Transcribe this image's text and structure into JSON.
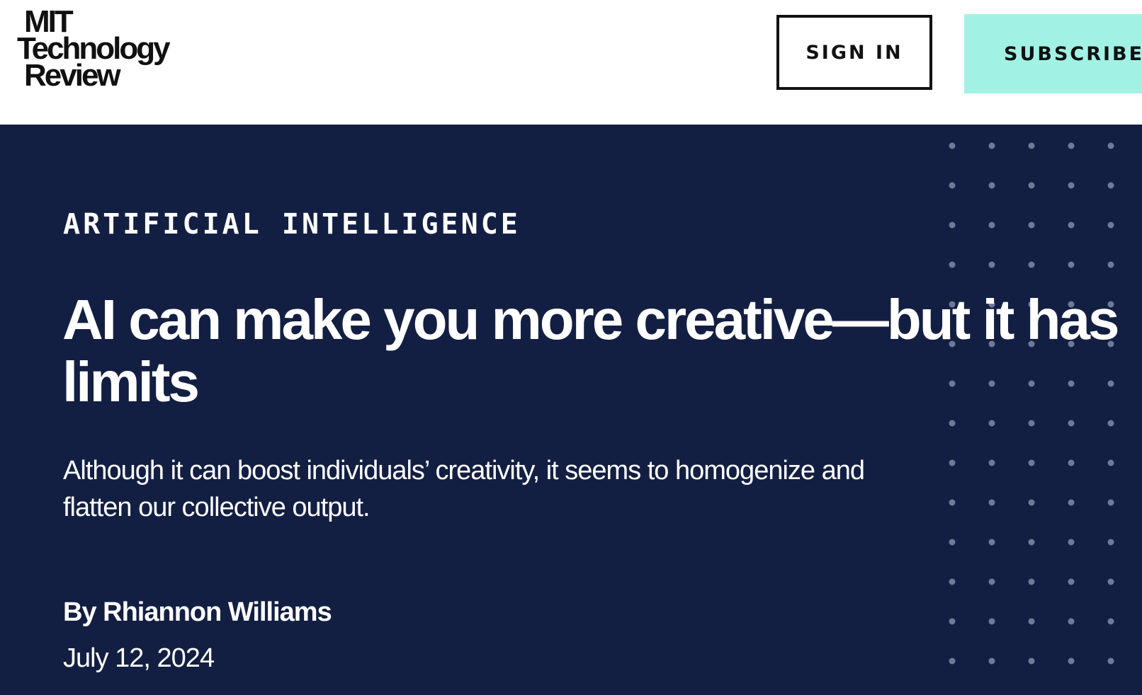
{
  "header": {
    "logo_lines": [
      "MIT",
      "Technology",
      "Review"
    ],
    "sign_in_label": "SIGN IN",
    "subscribe_label": "SUBSCRIBE"
  },
  "article": {
    "topic": "ARTIFICIAL INTELLIGENCE",
    "headline": "AI can make you more creative—but it has limits",
    "dek": "Although it can boost individuals’ creativity, it seems to homogenize and flatten our collective output.",
    "byline_prefix": "By",
    "author": "Rhiannon Williams",
    "date": "July 12, 2024"
  },
  "colors": {
    "hero_background": "#131f42",
    "subscribe_accent": "#a1f2e5",
    "dot_color": "#6f7a9a"
  },
  "icons": {
    "decor": "dot-grid-pattern"
  }
}
